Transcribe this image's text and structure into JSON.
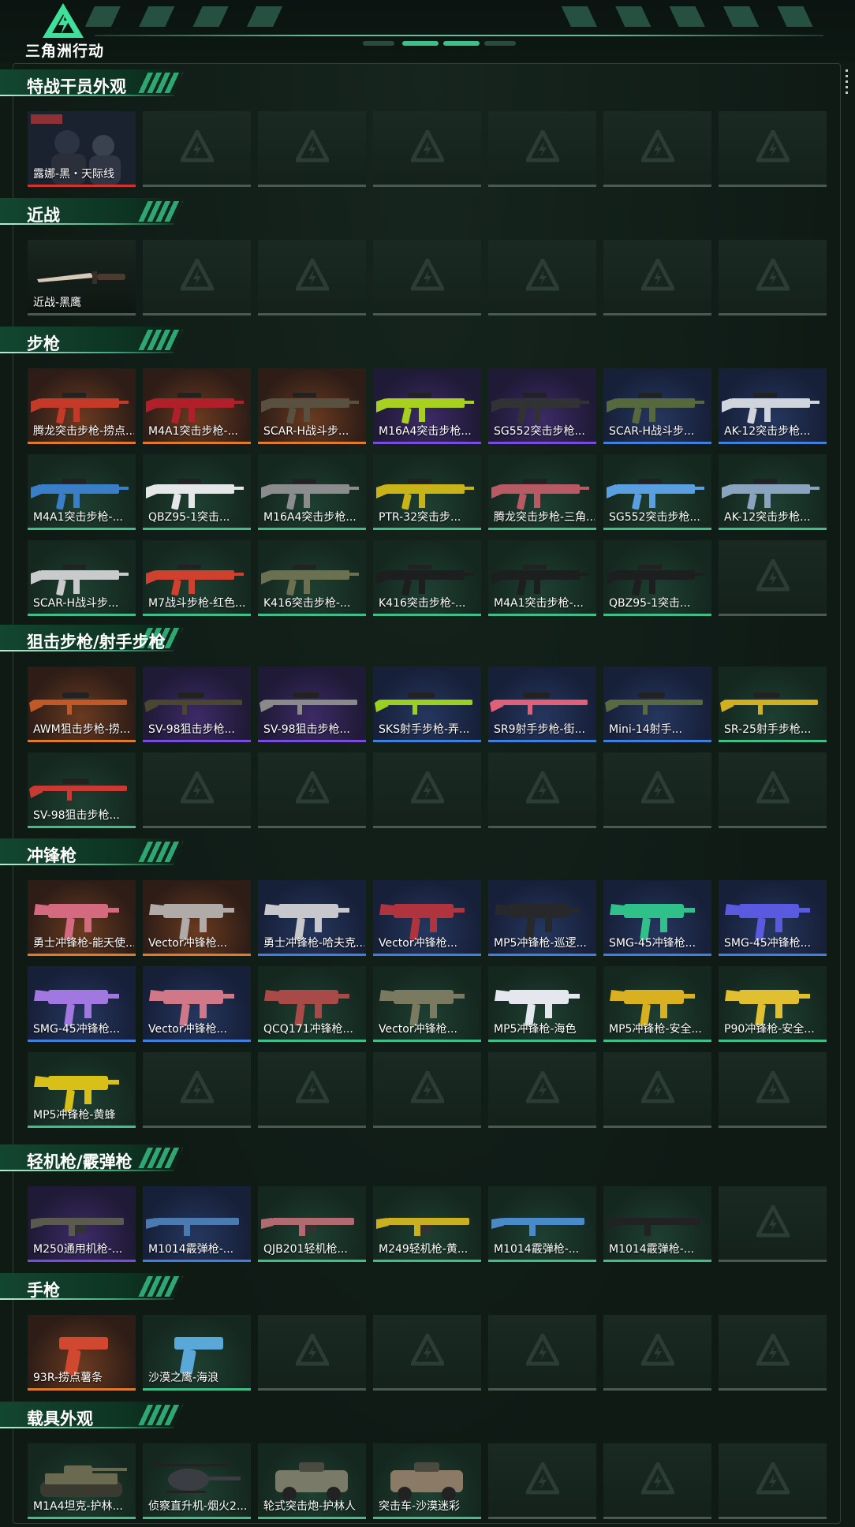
{
  "app": {
    "logo_text": "三角洲行动"
  },
  "colors": {
    "orange": "#e17a2a",
    "purple": "#7b4ae0",
    "blue": "#3e7fe0",
    "green": "#3fbf87",
    "red": "#d4332b",
    "grey": "#4a5a53",
    "accent": "#3cab7d"
  },
  "sections": [
    {
      "title": "特战干员外观",
      "items": [
        {
          "label": "露娜-黑・天际线",
          "rarity": "red",
          "icon": "operator-portrait"
        }
      ]
    },
    {
      "title": "近战",
      "items": [
        {
          "label": "近战-黑鹰",
          "rarity": "grey",
          "icon": "knife-icon"
        }
      ]
    },
    {
      "title": "步枪",
      "items": [
        {
          "label": "腾龙突击步枪-捞点...",
          "rarity": "orange",
          "icon": "rifle-icon",
          "tint": "#c33a28"
        },
        {
          "label": "M4A1突击步枪-...",
          "rarity": "orange",
          "icon": "rifle-icon",
          "tint": "#b0202a"
        },
        {
          "label": "SCAR-H战斗步...",
          "rarity": "orange",
          "icon": "rifle-icon",
          "tint": "#5a5040"
        },
        {
          "label": "M16A4突击步枪...",
          "rarity": "purple",
          "icon": "rifle-icon",
          "tint": "#a8d020"
        },
        {
          "label": "SG552突击步枪...",
          "rarity": "purple",
          "icon": "rifle-icon",
          "tint": "#303234"
        },
        {
          "label": "SCAR-H战斗步...",
          "rarity": "blue",
          "icon": "rifle-icon",
          "tint": "#55683e"
        },
        {
          "label": "AK-12突击步枪...",
          "rarity": "blue",
          "icon": "rifle-icon",
          "tint": "#d0d4dc"
        },
        {
          "label": "M4A1突击步枪-...",
          "rarity": "green",
          "icon": "rifle-icon",
          "tint": "#3a7ec8"
        },
        {
          "label": "QBZ95-1突击...",
          "rarity": "green",
          "icon": "rifle-icon",
          "tint": "#e4e6e8"
        },
        {
          "label": "M16A4突击步枪...",
          "rarity": "green",
          "icon": "rifle-icon",
          "tint": "#8a8c8e"
        },
        {
          "label": "PTR-32突击步...",
          "rarity": "green",
          "icon": "rifle-icon",
          "tint": "#c8b418"
        },
        {
          "label": "腾龙突击步枪-三角...",
          "rarity": "green",
          "icon": "rifle-icon",
          "tint": "#b85a64"
        },
        {
          "label": "SG552突击步枪...",
          "rarity": "green",
          "icon": "rifle-icon",
          "tint": "#5aa0e0"
        },
        {
          "label": "AK-12突击步枪...",
          "rarity": "green",
          "icon": "rifle-icon",
          "tint": "#8aa4c0"
        },
        {
          "label": "SCAR-H战斗步...",
          "rarity": "green",
          "icon": "rifle-icon",
          "tint": "#c8cacc"
        },
        {
          "label": "M7战斗步枪-红色...",
          "rarity": "green",
          "icon": "rifle-icon",
          "tint": "#d0402e"
        },
        {
          "label": "K416突击步枪-...",
          "rarity": "green",
          "icon": "rifle-icon",
          "tint": "#6a7050"
        },
        {
          "label": "K416突击步枪-...",
          "rarity": "green",
          "icon": "rifle-icon",
          "tint": "#1c1e20"
        },
        {
          "label": "M4A1突击步枪-...",
          "rarity": "green",
          "icon": "rifle-icon",
          "tint": "#1c1e20"
        },
        {
          "label": "QBZ95-1突击...",
          "rarity": "green",
          "icon": "rifle-icon",
          "tint": "#1c1e20"
        }
      ]
    },
    {
      "title": "狙击步枪/射手步枪",
      "items": [
        {
          "label": "AWM狙击步枪-捞...",
          "rarity": "orange",
          "icon": "sniper-icon",
          "tint": "#c05828"
        },
        {
          "label": "SV-98狙击步枪...",
          "rarity": "purple",
          "icon": "sniper-icon",
          "tint": "#4a4630"
        },
        {
          "label": "SV-98狙击步枪...",
          "rarity": "purple",
          "icon": "sniper-icon",
          "tint": "#8a8a8a"
        },
        {
          "label": "SKS射手步枪-弄...",
          "rarity": "blue",
          "icon": "sniper-icon",
          "tint": "#9ad020"
        },
        {
          "label": "SR9射手步枪-街...",
          "rarity": "blue",
          "icon": "sniper-icon",
          "tint": "#e0607a"
        },
        {
          "label": "Mini-14射手...",
          "rarity": "blue",
          "icon": "sniper-icon",
          "tint": "#5a6a40"
        },
        {
          "label": "SR-25射手步枪...",
          "rarity": "green",
          "icon": "sniper-icon",
          "tint": "#d0b020"
        },
        {
          "label": "SV-98狙击步枪...",
          "rarity": "green",
          "icon": "sniper-icon",
          "tint": "#c83a34"
        }
      ]
    },
    {
      "title": "冲锋枪",
      "items": [
        {
          "label": "勇士冲锋枪-能天使...",
          "rarity": "orange",
          "icon": "smg-icon",
          "tint": "#d46a80"
        },
        {
          "label": "Vector冲锋枪...",
          "rarity": "orange",
          "icon": "smg-icon",
          "tint": "#b0aaa8"
        },
        {
          "label": "勇士冲锋枪-哈夫克...",
          "rarity": "blue",
          "icon": "smg-icon",
          "tint": "#c8c8cc"
        },
        {
          "label": "Vector冲锋枪...",
          "rarity": "blue",
          "icon": "smg-icon",
          "tint": "#b0343e"
        },
        {
          "label": "MP5冲锋枪-巡逻...",
          "rarity": "blue",
          "icon": "smg-icon",
          "tint": "#26282a"
        },
        {
          "label": "SMG-45冲锋枪...",
          "rarity": "blue",
          "icon": "smg-icon",
          "tint": "#30c08a"
        },
        {
          "label": "SMG-45冲锋枪...",
          "rarity": "blue",
          "icon": "smg-icon",
          "tint": "#5a5ae0"
        },
        {
          "label": "SMG-45冲锋枪...",
          "rarity": "blue",
          "icon": "smg-icon",
          "tint": "#a078e0"
        },
        {
          "label": "Vector冲锋枪...",
          "rarity": "blue",
          "icon": "smg-icon",
          "tint": "#d07888"
        },
        {
          "label": "QCQ171冲锋枪...",
          "rarity": "green",
          "icon": "smg-icon",
          "tint": "#a84a48"
        },
        {
          "label": "Vector冲锋枪...",
          "rarity": "green",
          "icon": "smg-icon",
          "tint": "#7a7a60"
        },
        {
          "label": "MP5冲锋枪-海色",
          "rarity": "green",
          "icon": "smg-icon",
          "tint": "#e4e8ee"
        },
        {
          "label": "MP5冲锋枪-安全...",
          "rarity": "green",
          "icon": "smg-icon",
          "tint": "#d8b020"
        },
        {
          "label": "P90冲锋枪-安全...",
          "rarity": "green",
          "icon": "smg-icon",
          "tint": "#e0c030"
        },
        {
          "label": "MP5冲锋枪-黄蜂",
          "rarity": "green",
          "icon": "smg-icon",
          "tint": "#d8c018"
        }
      ]
    },
    {
      "title": "轻机枪/霰弹枪",
      "items": [
        {
          "label": "M250通用机枪-...",
          "rarity": "purple",
          "icon": "lmg-icon",
          "tint": "#5a5a50"
        },
        {
          "label": "M1014霰弹枪-...",
          "rarity": "blue",
          "icon": "shotgun-icon",
          "tint": "#4a7ab0"
        },
        {
          "label": "QJB201轻机枪...",
          "rarity": "green",
          "icon": "lmg-icon",
          "tint": "#b06a70"
        },
        {
          "label": "M249轻机枪-黄...",
          "rarity": "green",
          "icon": "lmg-icon",
          "tint": "#c8b020"
        },
        {
          "label": "M1014霰弹枪-...",
          "rarity": "green",
          "icon": "shotgun-icon",
          "tint": "#4a8ac8"
        },
        {
          "label": "M1014霰弹枪-...",
          "rarity": "green",
          "icon": "shotgun-icon",
          "tint": "#202224"
        }
      ]
    },
    {
      "title": "手枪",
      "items": [
        {
          "label": "93R-捞点薯条",
          "rarity": "orange",
          "icon": "pistol-icon",
          "tint": "#d04830"
        },
        {
          "label": "沙漠之鹰-海浪",
          "rarity": "green",
          "icon": "pistol-icon",
          "tint": "#5aa8d8"
        }
      ]
    },
    {
      "title": "载具外观",
      "items": [
        {
          "label": "M1A4坦克-护林...",
          "rarity": "green",
          "icon": "tank-icon",
          "tint": "#6a6a50"
        },
        {
          "label": "侦察直升机-烟火2...",
          "rarity": "green",
          "icon": "helicopter-icon",
          "tint": "#3a3e42"
        },
        {
          "label": "轮式突击炮-护林人",
          "rarity": "green",
          "icon": "armored-car-icon",
          "tint": "#7a7a68"
        },
        {
          "label": "突击车-沙漠迷彩",
          "rarity": "green",
          "icon": "assault-vehicle-icon",
          "tint": "#8a7a66"
        }
      ]
    }
  ]
}
